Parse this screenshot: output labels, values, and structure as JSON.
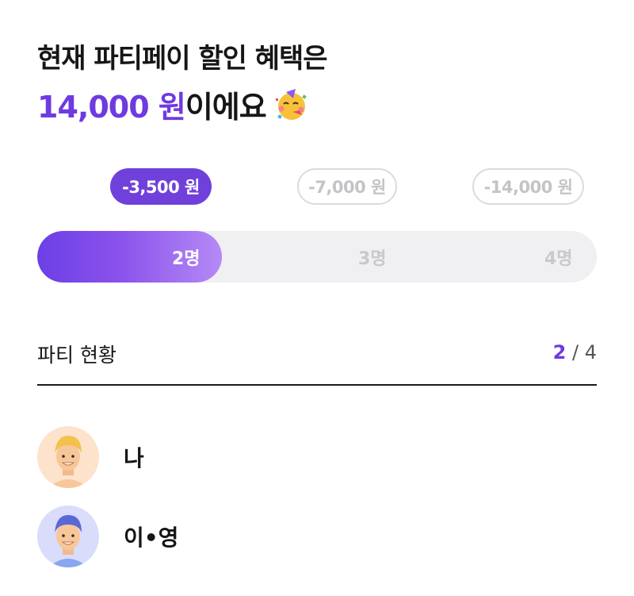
{
  "headline": {
    "line1": "현재 파티페이 할인 혜택은",
    "amount": "14,000 원",
    "suffix": "이에요",
    "emoji_icon": "party-face-icon"
  },
  "discount_chips": [
    {
      "label": "-3,500 원",
      "active": true
    },
    {
      "label": "-7,000 원",
      "active": false
    },
    {
      "label": "-14,000 원",
      "active": false
    }
  ],
  "party_size_slider": {
    "steps": [
      "2명",
      "3명",
      "4명"
    ],
    "selected": "2명",
    "fill_fraction": 0.33,
    "colors": {
      "fill_start": "#6c3fe6",
      "fill_end": "#b58af5",
      "track": "#f0f0f3"
    }
  },
  "party_status": {
    "title": "파티 현황",
    "current": "2",
    "separator": " / ",
    "total": "4"
  },
  "members": [
    {
      "name": "나",
      "avatar_icon": "blonde-man-avatar-icon"
    },
    {
      "name": "이•영",
      "avatar_icon": "blue-hair-man-avatar-icon"
    }
  ],
  "colors": {
    "accent": "#6f3ae0",
    "text": "#161616",
    "muted": "#c4c4c8"
  }
}
